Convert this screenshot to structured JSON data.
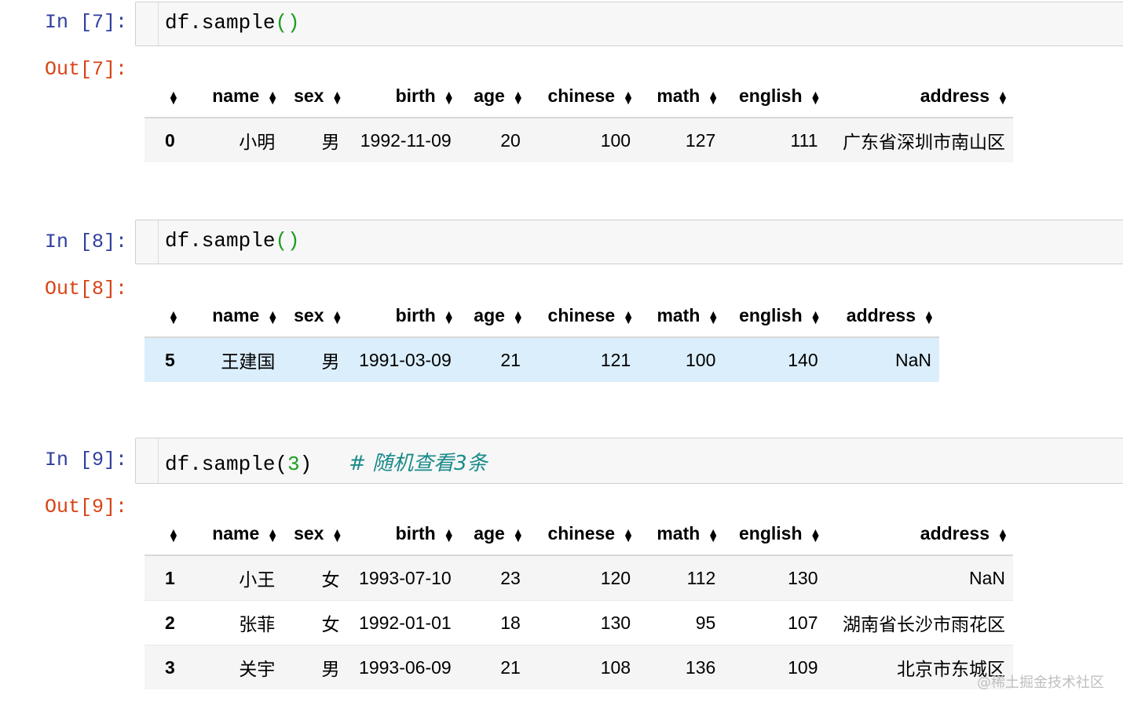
{
  "cells": [
    {
      "in_prompt": "In [7]:",
      "out_prompt": "Out[7]:",
      "code_fn": "df.sample",
      "code_arg": "",
      "comment": "",
      "columns": [
        "name",
        "sex",
        "birth",
        "age",
        "chinese",
        "math",
        "english",
        "address"
      ],
      "rows": [
        {
          "index": "0",
          "name": "小明",
          "sex": "男",
          "birth": "1992-11-09",
          "age": "20",
          "chinese": "100",
          "math": "127",
          "english": "111",
          "address": "广东省深圳市南山区"
        }
      ]
    },
    {
      "in_prompt": "In [8]:",
      "out_prompt": "Out[8]:",
      "code_fn": "df.sample",
      "code_arg": "",
      "comment": "",
      "columns": [
        "name",
        "sex",
        "birth",
        "age",
        "chinese",
        "math",
        "english",
        "address"
      ],
      "rows": [
        {
          "index": "5",
          "name": "王建国",
          "sex": "男",
          "birth": "1991-03-09",
          "age": "21",
          "chinese": "121",
          "math": "100",
          "english": "140",
          "address": "NaN"
        }
      ]
    },
    {
      "in_prompt": "In [9]:",
      "out_prompt": "Out[9]:",
      "code_fn": "df.sample",
      "code_arg": "3",
      "comment": "# 随机查看3条",
      "columns": [
        "name",
        "sex",
        "birth",
        "age",
        "chinese",
        "math",
        "english",
        "address"
      ],
      "rows": [
        {
          "index": "1",
          "name": "小王",
          "sex": "女",
          "birth": "1993-07-10",
          "age": "23",
          "chinese": "120",
          "math": "112",
          "english": "130",
          "address": "NaN"
        },
        {
          "index": "2",
          "name": "张菲",
          "sex": "女",
          "birth": "1992-01-01",
          "age": "18",
          "chinese": "130",
          "math": "95",
          "english": "107",
          "address": "湖南省长沙市雨花区"
        },
        {
          "index": "3",
          "name": "关宇",
          "sex": "男",
          "birth": "1993-06-09",
          "age": "21",
          "chinese": "108",
          "math": "136",
          "english": "109",
          "address": "北京市东城区"
        }
      ]
    }
  ],
  "watermark": "@稀土掘金技术社区",
  "colors": {
    "in_prompt": "#303f9f",
    "out_prompt": "#d84315",
    "row_highlight": "#dbeefc",
    "comment": "#1a8a8a"
  }
}
